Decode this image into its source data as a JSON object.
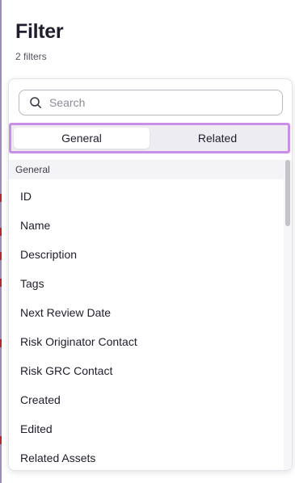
{
  "header": {
    "title": "Filter",
    "subtitle": "2 filters"
  },
  "search": {
    "placeholder": "Search",
    "value": ""
  },
  "tabs": [
    {
      "label": "General",
      "active": true
    },
    {
      "label": "Related",
      "active": false
    }
  ],
  "section": {
    "title": "General"
  },
  "items": [
    {
      "label": "ID"
    },
    {
      "label": "Name"
    },
    {
      "label": "Description"
    },
    {
      "label": "Tags"
    },
    {
      "label": "Next Review Date"
    },
    {
      "label": "Risk Originator Contact"
    },
    {
      "label": "Risk GRC Contact"
    },
    {
      "label": "Created"
    },
    {
      "label": "Edited"
    },
    {
      "label": "Related Assets"
    }
  ],
  "colors": {
    "tab_highlight": "#c98ee6",
    "accent_edge": "#4b2e83"
  }
}
